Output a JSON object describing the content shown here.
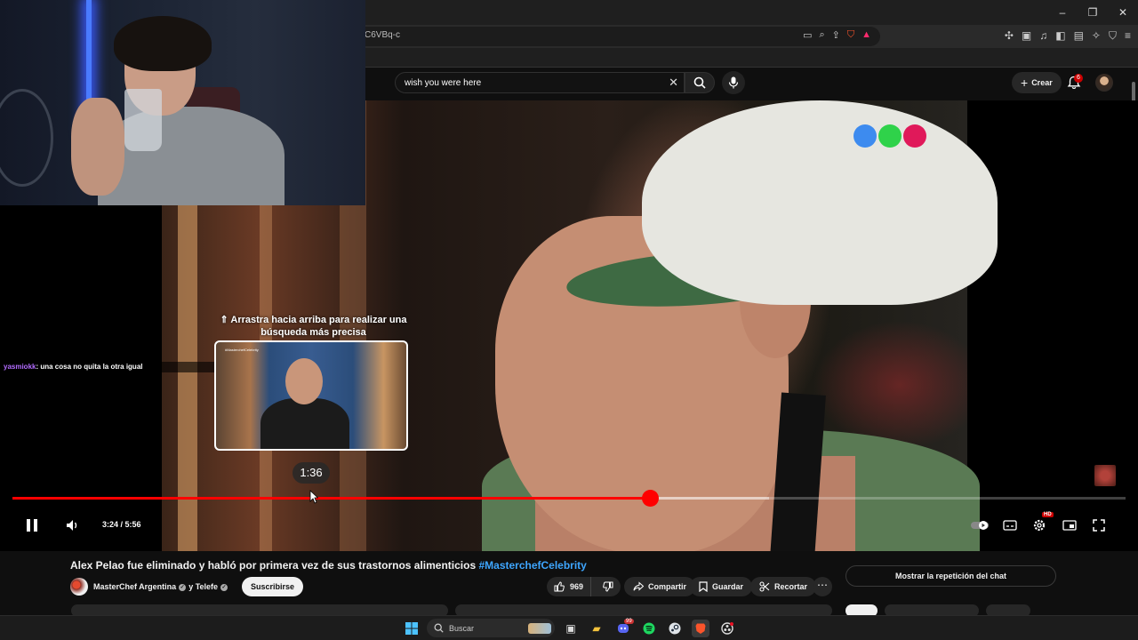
{
  "browser": {
    "url_fragment": "C6VBq-c",
    "window_controls": [
      "–",
      "❐",
      "✕"
    ]
  },
  "youtube_header": {
    "search_value": "wish you were here",
    "create_label": "Crear",
    "notifications_count": "6"
  },
  "video": {
    "drag_hint_line1": "⇑ Arrastra hacia arriba para realizar una",
    "drag_hint_line2": "búsqueda más precisa",
    "preview_tag": "#MasterchefCelebrity",
    "hover_time": "1:36",
    "current_time": "3:24",
    "separator": " / ",
    "duration": "5:56",
    "played_fraction": 0.573,
    "buffered_fraction": 0.68,
    "hd_badge": "HD",
    "logo_colors": [
      "#3d8bef",
      "#2fd24a",
      "#e0195a"
    ]
  },
  "chat_overlay": {
    "username": "yasmiokk",
    "message": ": una cosa no quita la otra igual"
  },
  "below_video": {
    "title": "Alex Pelao fue eliminado y habló por primera vez de sus trastornos alimenticios ",
    "title_hashtag": "#MasterchefCelebrity",
    "channel_name": "MasterChef Argentina",
    "channel_connector": "y Telefe",
    "subscribe_label": "Suscribirse",
    "like_count": "969",
    "share_label": "Compartir",
    "save_label": "Guardar",
    "clip_label": "Recortar",
    "more_label": "⋯",
    "chat_replay_label": "Mostrar la repetición del chat"
  },
  "taskbar": {
    "search_placeholder": "Buscar",
    "discord_badge": "99"
  },
  "colors": {
    "accent_red": "#ff0000",
    "link_blue": "#3ea6ff",
    "chat_user_purple": "#b26cff"
  }
}
